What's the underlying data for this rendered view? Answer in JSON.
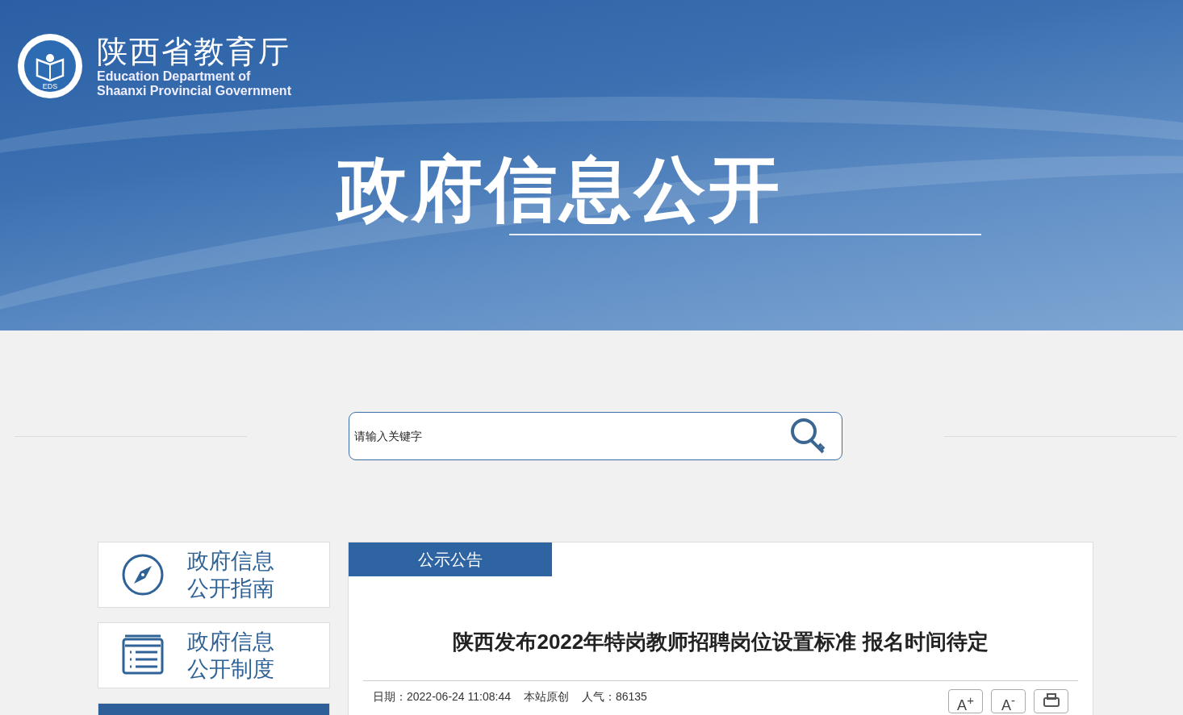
{
  "site": {
    "name_cn": "陕西省教育厅",
    "name_en": [
      "Education Department of",
      "Shaanxi Provincial Government"
    ],
    "logo_text": "EDS"
  },
  "banner": {
    "title": "政府信息公开"
  },
  "search": {
    "placeholder": "请输入关键字"
  },
  "sidebar": {
    "items": [
      {
        "lines": [
          "政府信息",
          "公开指南"
        ],
        "kind": "compass"
      },
      {
        "lines": [
          "政府信息",
          "公开制度"
        ],
        "kind": "list"
      }
    ]
  },
  "article": {
    "tabs": [
      {
        "label": "公示公告",
        "selected": true
      }
    ],
    "title": "陕西发布2022年特岗教师招聘岗位设置标准 报名时间待定",
    "meta": [
      "日期：2022-06-24 11:08:44",
      "本站原创",
      "人气：86135"
    ],
    "tools": [
      {
        "kind": "font-increase",
        "label": "A$^{+}$"
      },
      {
        "kind": "font-decrease",
        "label": "A$^{-}$"
      },
      {
        "kind": "print"
      }
    ]
  }
}
